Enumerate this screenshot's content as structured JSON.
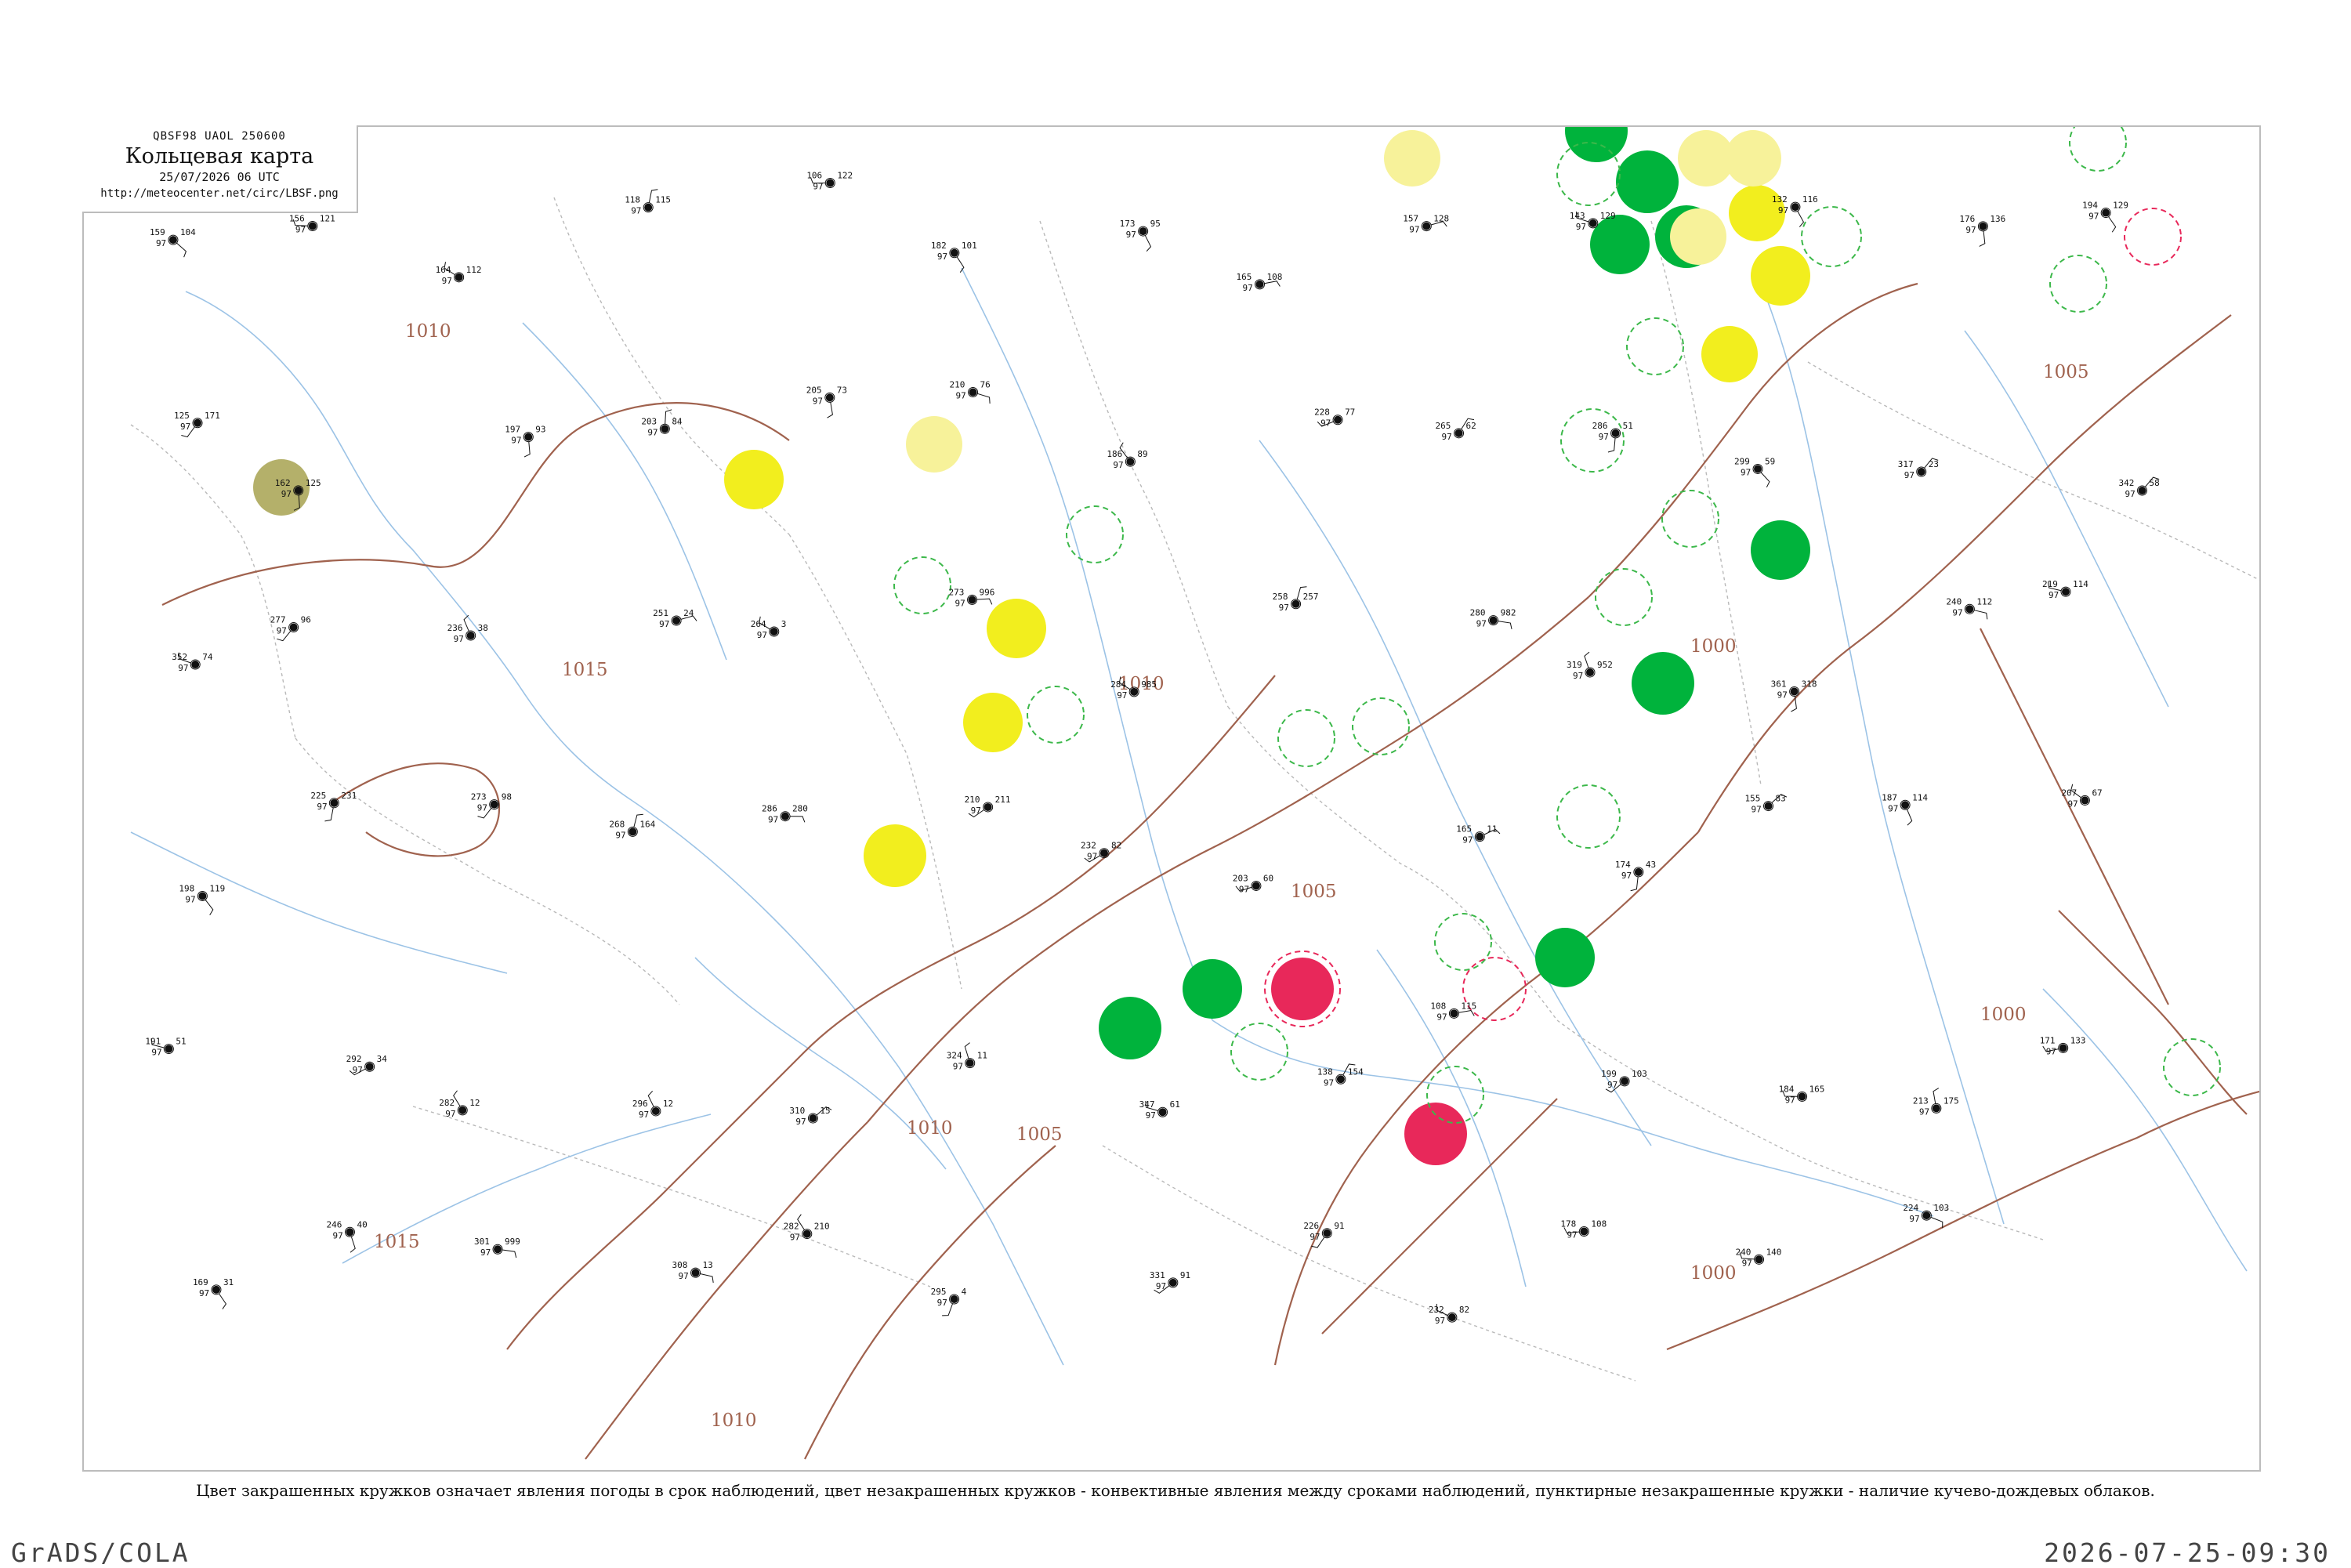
{
  "header": {
    "code_line": "QBSF98  UAOL  250600",
    "title": "Кольцевая карта",
    "date_line": "25/07/2026 06 UTC",
    "url": "http://meteocenter.net/circ/LBSF.png"
  },
  "isobar_labels": [
    "1010",
    "1015",
    "1010",
    "1005",
    "1000",
    "1005",
    "1010",
    "1015",
    "1010",
    "1005",
    "1000",
    "1000"
  ],
  "legend_note": "Цвет закрашенных кружков означает явления погоды в срок наблюдений, цвет незакрашенных кружков - конвективные явления между сроками наблюдений, пунктирные незакрашенные кружки - наличие кучево-дождевых облаков.",
  "footer": {
    "brand": "GrADS/COLA",
    "timestamp": "2026-07-25-09:30"
  },
  "colors": {
    "isobar": "#a0624e",
    "river": "#9cc3e6",
    "thunder_green": "#00b33c",
    "rain_yellow": "#f2ee1e",
    "shower_pale_yellow": "#f7f29a",
    "hail_red": "#e8285a",
    "haze_olive": "#b4b06a",
    "convective_outline_green": "#3cb84a",
    "convective_outline_red": "#e8285a"
  },
  "stations": [
    {
      "p": "159",
      "t": "97",
      "v": "104"
    },
    {
      "p": "156",
      "t": "97",
      "v": "121"
    },
    {
      "p": "164",
      "t": "97",
      "v": "112"
    },
    {
      "p": "118",
      "t": "97",
      "v": "115"
    },
    {
      "p": "106",
      "t": "97",
      "v": "122"
    },
    {
      "p": "182",
      "t": "97",
      "v": "101"
    },
    {
      "p": "173",
      "t": "97",
      "v": "95"
    },
    {
      "p": "165",
      "t": "97",
      "v": "108"
    },
    {
      "p": "157",
      "t": "97",
      "v": "128"
    },
    {
      "p": "143",
      "t": "97",
      "v": "129"
    },
    {
      "p": "132",
      "t": "97",
      "v": "116"
    },
    {
      "p": "176",
      "t": "97",
      "v": "136"
    },
    {
      "p": "194",
      "t": "97",
      "v": "129"
    },
    {
      "p": "125",
      "t": "97",
      "v": "171"
    },
    {
      "p": "162",
      "t": "97",
      "v": "125"
    },
    {
      "p": "197",
      "t": "97",
      "v": "93"
    },
    {
      "p": "203",
      "t": "97",
      "v": "84"
    },
    {
      "p": "205",
      "t": "97",
      "v": "73"
    },
    {
      "p": "210",
      "t": "97",
      "v": "76"
    },
    {
      "p": "186",
      "t": "97",
      "v": "89"
    },
    {
      "p": "228",
      "t": "97",
      "v": "77"
    },
    {
      "p": "265",
      "t": "97",
      "v": "62"
    },
    {
      "p": "286",
      "t": "97",
      "v": "51"
    },
    {
      "p": "299",
      "t": "97",
      "v": "59"
    },
    {
      "p": "317",
      "t": "97",
      "v": "23"
    },
    {
      "p": "342",
      "t": "97",
      "v": "58"
    },
    {
      "p": "352",
      "t": "97",
      "v": "74"
    },
    {
      "p": "277",
      "t": "97",
      "v": "96"
    },
    {
      "p": "236",
      "t": "97",
      "v": "38"
    },
    {
      "p": "251",
      "t": "97",
      "v": "24"
    },
    {
      "p": "264",
      "t": "97",
      "v": "3"
    },
    {
      "p": "273",
      "t": "97",
      "v": "996"
    },
    {
      "p": "284",
      "t": "97",
      "v": "985"
    },
    {
      "p": "258",
      "t": "97",
      "v": "257"
    },
    {
      "p": "280",
      "t": "97",
      "v": "982"
    },
    {
      "p": "319",
      "t": "97",
      "v": "952"
    },
    {
      "p": "361",
      "t": "97",
      "v": "318"
    },
    {
      "p": "240",
      "t": "97",
      "v": "112"
    },
    {
      "p": "219",
      "t": "97",
      "v": "114"
    },
    {
      "p": "198",
      "t": "97",
      "v": "119"
    },
    {
      "p": "225",
      "t": "97",
      "v": "231"
    },
    {
      "p": "273",
      "t": "97",
      "v": "98"
    },
    {
      "p": "268",
      "t": "97",
      "v": "164"
    },
    {
      "p": "286",
      "t": "97",
      "v": "280"
    },
    {
      "p": "210",
      "t": "97",
      "v": "211"
    },
    {
      "p": "232",
      "t": "97",
      "v": "82"
    },
    {
      "p": "203",
      "t": "97",
      "v": "60"
    },
    {
      "p": "165",
      "t": "97",
      "v": "11"
    },
    {
      "p": "174",
      "t": "97",
      "v": "43"
    },
    {
      "p": "155",
      "t": "97",
      "v": "83"
    },
    {
      "p": "187",
      "t": "97",
      "v": "114"
    },
    {
      "p": "207",
      "t": "97",
      "v": "67"
    },
    {
      "p": "191",
      "t": "97",
      "v": "51"
    },
    {
      "p": "292",
      "t": "97",
      "v": "34"
    },
    {
      "p": "282",
      "t": "97",
      "v": "12"
    },
    {
      "p": "296",
      "t": "97",
      "v": "12"
    },
    {
      "p": "310",
      "t": "97",
      "v": "15"
    },
    {
      "p": "324",
      "t": "97",
      "v": "11"
    },
    {
      "p": "347",
      "t": "97",
      "v": "61"
    },
    {
      "p": "138",
      "t": "97",
      "v": "154"
    },
    {
      "p": "108",
      "t": "97",
      "v": "115"
    },
    {
      "p": "199",
      "t": "97",
      "v": "103"
    },
    {
      "p": "184",
      "t": "97",
      "v": "165"
    },
    {
      "p": "213",
      "t": "97",
      "v": "175"
    },
    {
      "p": "171",
      "t": "97",
      "v": "133"
    },
    {
      "p": "169",
      "t": "97",
      "v": "31"
    },
    {
      "p": "246",
      "t": "97",
      "v": "40"
    },
    {
      "p": "301",
      "t": "97",
      "v": "999"
    },
    {
      "p": "308",
      "t": "97",
      "v": "13"
    },
    {
      "p": "282",
      "t": "97",
      "v": "210"
    },
    {
      "p": "295",
      "t": "97",
      "v": "4"
    },
    {
      "p": "331",
      "t": "97",
      "v": "91"
    },
    {
      "p": "226",
      "t": "97",
      "v": "91"
    },
    {
      "p": "232",
      "t": "97",
      "v": "82"
    },
    {
      "p": "178",
      "t": "97",
      "v": "108"
    },
    {
      "p": "240",
      "t": "97",
      "v": "140"
    },
    {
      "p": "224",
      "t": "97",
      "v": "103"
    }
  ]
}
